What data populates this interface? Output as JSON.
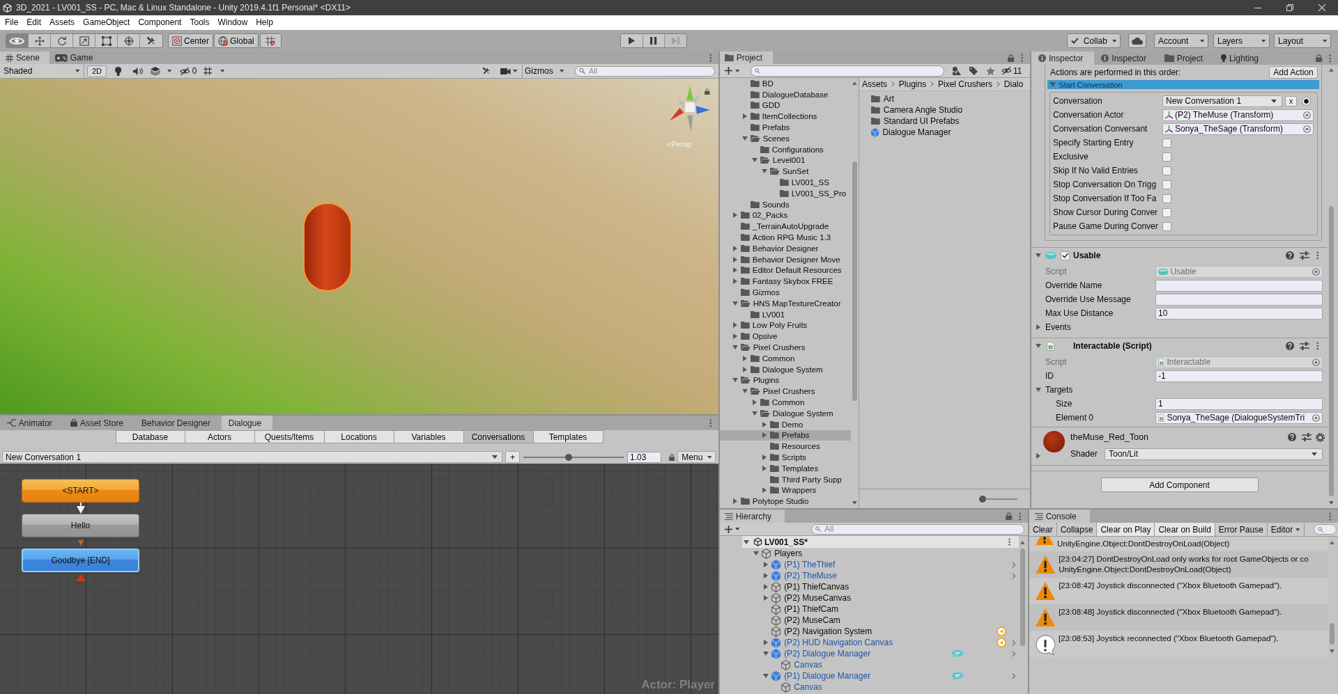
{
  "window": {
    "title": "3D_2021 - LV001_SS - PC, Mac & Linux Standalone - Unity 2019.4.1f1 Personal* <DX11>"
  },
  "menu": [
    "File",
    "Edit",
    "Assets",
    "GameObject",
    "Component",
    "Tools",
    "Window",
    "Help"
  ],
  "toolbar": {
    "tools": [
      {
        "kind": "view",
        "selected": true
      },
      {
        "kind": "move",
        "selected": false
      },
      {
        "kind": "rotate",
        "selected": false
      },
      {
        "kind": "scale",
        "selected": false
      },
      {
        "kind": "rect",
        "selected": false
      },
      {
        "kind": "transform",
        "selected": false
      },
      {
        "kind": "custom",
        "selected": false
      }
    ],
    "pivot_mode": "Center",
    "pivot_rotation": "Global",
    "playback": [
      {
        "kind": "play",
        "disabled": false
      },
      {
        "kind": "pause",
        "disabled": false
      },
      {
        "kind": "step",
        "disabled": true
      }
    ],
    "collab": "Collab",
    "account": "Account",
    "layers": "Layers",
    "layout": "Layout"
  },
  "scene_panel": {
    "tabs": [
      {
        "label": "Scene",
        "kind": "scene",
        "selected": true
      },
      {
        "label": "Game",
        "kind": "game",
        "selected": false
      }
    ],
    "draw_mode": "Shaded",
    "mode_2d": "2D",
    "hidden_count": "0",
    "gizmos": "Gizmos",
    "search_placeholder": "All",
    "projection": "<Persp"
  },
  "dialogue_panel": {
    "tabs": [
      {
        "label": "Animator",
        "kind": "animator",
        "selected": false
      },
      {
        "label": "Asset Store",
        "kind": "store",
        "selected": false
      },
      {
        "label": "Behavior Designer",
        "kind": "plain",
        "selected": false
      },
      {
        "label": "Dialogue",
        "kind": "plain",
        "selected": true
      }
    ],
    "sections": [
      {
        "label": "Database",
        "selected": false
      },
      {
        "label": "Actors",
        "selected": false
      },
      {
        "label": "Quests/Items",
        "selected": false
      },
      {
        "label": "Locations",
        "selected": false
      },
      {
        "label": "Variables",
        "selected": false
      },
      {
        "label": "Conversations",
        "selected": true
      },
      {
        "label": "Templates",
        "selected": false
      }
    ],
    "conversation": "New Conversation 1",
    "add": "+",
    "zoom_slider": {
      "level": 0.45
    },
    "zoom_value": "1.03",
    "menu": "Menu",
    "nodes": [
      {
        "label": "<START>",
        "kind": "start",
        "selected": false
      },
      {
        "label": "Hello",
        "kind": "npc",
        "selected": false
      },
      {
        "label": "Goodbye [END]",
        "kind": "player",
        "selected": true
      }
    ],
    "actor_label": "Actor: Player"
  },
  "project_panel": {
    "title": "Project",
    "hidden_count": "11",
    "tree_continued": [
      {
        "label": "BD",
        "selected": false
      },
      {
        "label": "DialogueDatabase",
        "selected": false
      },
      {
        "label": "GDD",
        "selected": false
      },
      {
        "label": "ItemCollections",
        "expanded": false,
        "selected": false
      },
      {
        "label": "Prefabs",
        "selected": false
      },
      {
        "label": "Scenes",
        "expanded": true,
        "selected": false,
        "children": [
          {
            "label": "Configurations",
            "selected": false
          },
          {
            "label": "Level001",
            "expanded": true,
            "selected": false,
            "children": [
              {
                "label": "SunSet",
                "expanded": true,
                "selected": false,
                "children": [
                  {
                    "label": "LV001_SS",
                    "selected": false
                  },
                  {
                    "label": "LV001_SS_Pro",
                    "selected": false
                  }
                ]
              }
            ]
          }
        ]
      },
      {
        "label": "Sounds",
        "selected": false
      }
    ],
    "tree": [
      {
        "label": "02_Packs",
        "expanded": false,
        "selected": false
      },
      {
        "label": "_TerrainAutoUpgrade",
        "selected": false
      },
      {
        "label": "Action RPG Music 1.3",
        "selected": false
      },
      {
        "label": "Behavior Designer",
        "expanded": false,
        "selected": false
      },
      {
        "label": "Behavior Designer Move",
        "expanded": false,
        "selected": false
      },
      {
        "label": "Editor Default Resources",
        "expanded": false,
        "selected": false
      },
      {
        "label": "Fantasy Skybox FREE",
        "expanded": false,
        "selected": false
      },
      {
        "label": "Gizmos",
        "selected": false
      },
      {
        "label": "HNS MapTextureCreator",
        "expanded": true,
        "selected": false,
        "children": [
          {
            "label": "LV001",
            "selected": false
          }
        ]
      },
      {
        "label": "Low Poly Fruits",
        "expanded": false,
        "selected": false
      },
      {
        "label": "Opsive",
        "expanded": false,
        "selected": false
      },
      {
        "label": "Pixel Crushers",
        "expanded": true,
        "selected": false,
        "children": [
          {
            "label": "Common",
            "expanded": false,
            "selected": false
          },
          {
            "label": "Dialogue System",
            "expanded": false,
            "selected": false
          }
        ]
      },
      {
        "label": "Plugins",
        "expanded": true,
        "selected": false,
        "children": [
          {
            "label": "Pixel Crushers",
            "expanded": true,
            "selected": false,
            "children": [
              {
                "label": "Common",
                "expanded": false,
                "selected": false
              },
              {
                "label": "Dialogue System",
                "expanded": true,
                "selected": false,
                "children": [
                  {
                    "label": "Demo",
                    "expanded": false,
                    "selected": false
                  },
                  {
                    "label": "Prefabs",
                    "expanded": false,
                    "selected": true
                  },
                  {
                    "label": "Resources",
                    "selected": false
                  },
                  {
                    "label": "Scripts",
                    "expanded": false,
                    "selected": false
                  },
                  {
                    "label": "Templates",
                    "expanded": false,
                    "selected": false
                  },
                  {
                    "label": "Third Party Supp",
                    "selected": false
                  },
                  {
                    "label": "Wrappers",
                    "expanded": false,
                    "selected": false
                  }
                ]
              }
            ]
          }
        ]
      },
      {
        "label": "Polytope Studio",
        "expanded": false,
        "selected": false
      }
    ],
    "breadcrumb": [
      "Assets",
      "Plugins",
      "Pixel Crushers",
      "Dialo"
    ],
    "items": [
      {
        "label": "Art",
        "kind": "folder"
      },
      {
        "label": "Camera Angle Studio",
        "kind": "folder"
      },
      {
        "label": "Standard UI Prefabs",
        "kind": "folder"
      },
      {
        "label": "Dialogue Manager",
        "kind": "prefab"
      }
    ],
    "size_slider": {
      "level": 0
    }
  },
  "inspector_panel": {
    "tabs": [
      {
        "label": "Inspector",
        "kind": "info",
        "selected": true
      },
      {
        "label": "Inspector",
        "kind": "info",
        "selected": false
      },
      {
        "label": "Project",
        "kind": "folder",
        "selected": false
      },
      {
        "label": "Lighting",
        "kind": "light",
        "selected": false
      }
    ],
    "actions_label": "Actions are performed in this order:",
    "add_action": "Add Action",
    "action": {
      "title": "Start Conversation",
      "expanded": true,
      "fields": [
        {
          "label": "Conversation",
          "kind": "popup",
          "value": "New Conversation 1",
          "clear": "x"
        },
        {
          "label": "Conversation Actor",
          "kind": "transform_ref",
          "value": "(P2) TheMuse (Transform)"
        },
        {
          "label": "Conversation Conversant",
          "kind": "transform_ref",
          "value": "Sonya_TheSage (Transform)"
        },
        {
          "label": "Specify Starting Entry",
          "kind": "toggle",
          "checked": false
        },
        {
          "label": "Exclusive",
          "kind": "toggle",
          "checked": false
        },
        {
          "label": "Skip If No Valid Entries",
          "kind": "toggle",
          "checked": false
        },
        {
          "label": "Stop Conversation On Trigg",
          "kind": "toggle",
          "checked": false
        },
        {
          "label": "Stop Conversation If Too Fa",
          "kind": "toggle",
          "checked": false
        },
        {
          "label": "Show Cursor During Conver",
          "kind": "toggle",
          "checked": false
        },
        {
          "label": "Pause Game During Conver",
          "kind": "toggle",
          "checked": false
        }
      ]
    },
    "components": [
      {
        "title": "Usable",
        "kind": "usable",
        "expanded": true,
        "enabled": true,
        "fields": [
          {
            "label": "Script",
            "kind": "script",
            "value": "Usable"
          },
          {
            "label": "Override Name",
            "kind": "text"
          },
          {
            "label": "Override Use Message",
            "kind": "text"
          },
          {
            "label": "Max Use Distance",
            "kind": "text",
            "value": "10"
          },
          {
            "label": "Events",
            "kind": "foldout",
            "expanded": false
          }
        ]
      },
      {
        "title": "Interactable (Script)",
        "kind": "script",
        "expanded": true,
        "fields": [
          {
            "label": "Script",
            "kind": "script",
            "value": "Interactable"
          },
          {
            "label": "ID",
            "kind": "text",
            "value": "-1"
          },
          {
            "label": "Targets",
            "kind": "foldout",
            "expanded": true,
            "children": [
              {
                "label": "Size",
                "kind": "text",
                "value": "1"
              },
              {
                "label": "Element 0",
                "kind": "component_ref",
                "value": "Sonya_TheSage (DialogueSystemTri"
              }
            ]
          }
        ]
      }
    ],
    "material": {
      "name": "theMuse_Red_Toon",
      "shader_label": "Shader",
      "shader": "Toon/Lit",
      "expanded": false
    },
    "add_component": "Add Component"
  },
  "hierarchy_panel": {
    "title": "Hierarchy",
    "search_placeholder": "All",
    "scene": {
      "label": "LV001_SS*",
      "expanded": true
    },
    "objects": [
      {
        "label": "Players",
        "expanded": true,
        "prefab": false,
        "instance_root": false,
        "kind": "plain",
        "children": [
          {
            "label": "(P1) TheThief",
            "expanded": false,
            "prefab": true,
            "instance_root": true,
            "kind": "plain"
          },
          {
            "label": "(P2) TheMuse",
            "expanded": false,
            "prefab": true,
            "instance_root": true,
            "kind": "plain"
          },
          {
            "label": "(P1) ThiefCanvas",
            "expanded": false,
            "prefab": false,
            "instance_root": false,
            "kind": "plain"
          },
          {
            "label": "(P2) MuseCanvas",
            "expanded": false,
            "prefab": false,
            "instance_root": false,
            "kind": "plain"
          },
          {
            "label": "(P1) ThiefCam",
            "prefab": false,
            "instance_root": false,
            "kind": "plain"
          },
          {
            "label": "(P2) MuseCam",
            "prefab": false,
            "instance_root": false,
            "kind": "plain"
          },
          {
            "label": "(P2) Navigation System",
            "prefab": false,
            "instance_root": false,
            "kind": "navigation"
          },
          {
            "label": "(P2) HUD Navigation Canvas",
            "expanded": false,
            "prefab": true,
            "instance_root": true,
            "kind": "navigation"
          },
          {
            "label": "(P2) Dialogue Manager",
            "expanded": true,
            "prefab": true,
            "instance_root": true,
            "kind": "dialogue",
            "children": [
              {
                "label": "Canvas",
                "prefab": true,
                "instance_root": false,
                "kind": "plain"
              }
            ]
          },
          {
            "label": "(P1) Dialogue Manager",
            "expanded": true,
            "prefab": true,
            "instance_root": true,
            "kind": "dialogue",
            "children": [
              {
                "label": "Canvas",
                "prefab": true,
                "instance_root": false,
                "kind": "plain"
              }
            ]
          }
        ]
      }
    ]
  },
  "console_panel": {
    "title": "Console",
    "buttons": [
      {
        "label": "Clear",
        "on": false
      },
      {
        "label": "Collapse",
        "on": false
      },
      {
        "label": "Clear on Play",
        "on": true
      },
      {
        "label": "Clear on Build",
        "on": true
      },
      {
        "label": "Error Pause",
        "on": false
      }
    ],
    "filter": "Editor",
    "entries": [
      {
        "kind": "warning",
        "lines": [
          "UnityEngine.Object:DontDestroyOnLoad(Object)"
        ]
      },
      {
        "kind": "warning",
        "lines": [
          "[23:04:27] DontDestroyOnLoad only works for root GameObjects or co",
          "UnityEngine.Object:DontDestroyOnLoad(Object)"
        ]
      },
      {
        "kind": "warning",
        "lines": [
          "[23:08:42] Joystick disconnected (\"Xbox Bluetooth Gamepad\")."
        ]
      },
      {
        "kind": "warning",
        "lines": [
          "[23:08:48] Joystick disconnected (\"Xbox Bluetooth Gamepad\")."
        ]
      },
      {
        "kind": "info",
        "lines": [
          "[23:08:53] Joystick reconnected (\"Xbox Bluetooth Gamepad\")."
        ]
      }
    ]
  }
}
